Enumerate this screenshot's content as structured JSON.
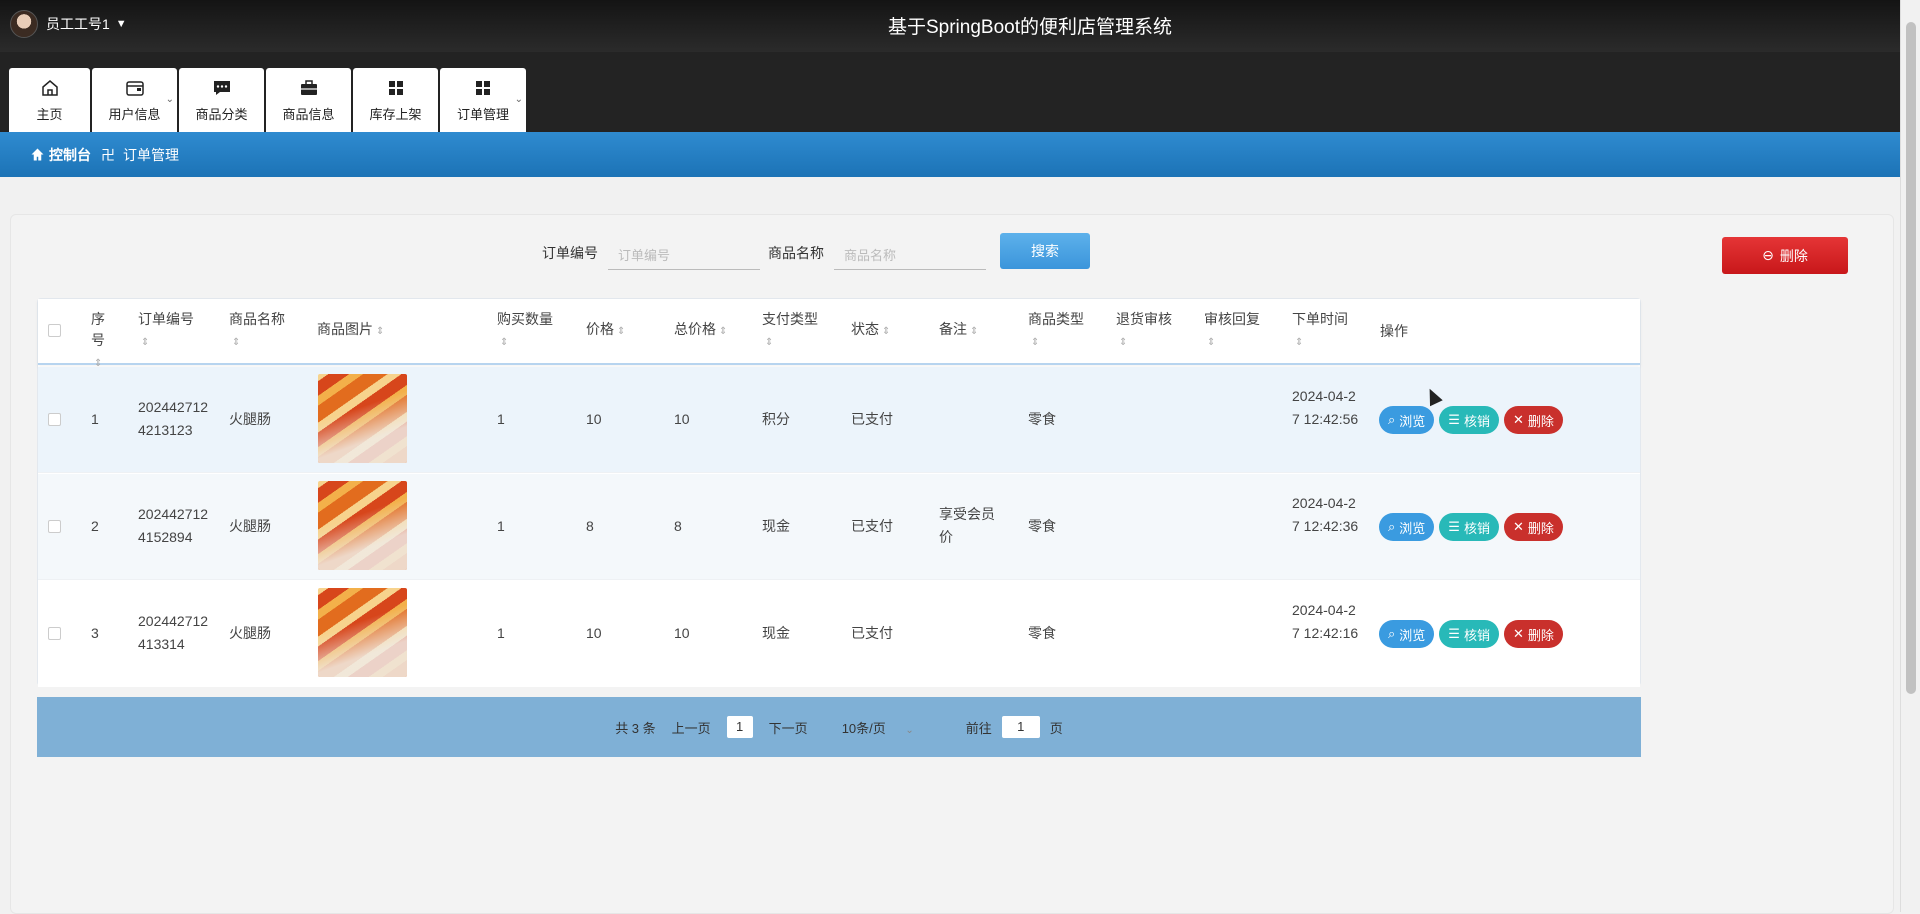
{
  "header": {
    "user_name": "员工工号1",
    "title": "基于SpringBoot的便利店管理系统"
  },
  "nav": [
    {
      "label": "主页",
      "icon": "home-icon"
    },
    {
      "label": "用户信息",
      "icon": "wallet-icon"
    },
    {
      "label": "商品分类",
      "icon": "chat-icon"
    },
    {
      "label": "商品信息",
      "icon": "briefcase-icon"
    },
    {
      "label": "库存上架",
      "icon": "grid-icon"
    },
    {
      "label": "订单管理",
      "icon": "grid-icon"
    }
  ],
  "breadcrumb": {
    "home": "控制台",
    "current": "订单管理"
  },
  "search": {
    "order_label": "订单编号",
    "order_placeholder": "订单编号",
    "goods_label": "商品名称",
    "goods_placeholder": "商品名称",
    "button": "搜索"
  },
  "delete_button": "删除",
  "table": {
    "headers": {
      "seq": "序号",
      "order": "订单编号",
      "name": "商品名称",
      "image": "商品图片",
      "qty": "购买数量",
      "price": "价格",
      "total": "总价格",
      "paytype": "支付类型",
      "status": "状态",
      "remark": "备注",
      "category": "商品类型",
      "refund": "退货审核",
      "reply": "审核回复",
      "time": "下单时间",
      "ops": "操作"
    },
    "rows": [
      {
        "seq": "1",
        "order": "2024427124213123",
        "name": "火腿肠",
        "qty": "1",
        "price": "10",
        "total": "10",
        "paytype": "积分",
        "status": "已支付",
        "remark": "",
        "category": "零食",
        "time": "2024-04-27 12:42:56"
      },
      {
        "seq": "2",
        "order": "2024427124152894",
        "name": "火腿肠",
        "qty": "1",
        "price": "8",
        "total": "8",
        "paytype": "现金",
        "status": "已支付",
        "remark": "享受会员价",
        "category": "零食",
        "time": "2024-04-27 12:42:36"
      },
      {
        "seq": "3",
        "order": "202442712413314",
        "name": "火腿肠",
        "qty": "1",
        "price": "10",
        "total": "10",
        "paytype": "现金",
        "status": "已支付",
        "remark": "",
        "category": "零食",
        "time": "2024-04-27 12:42:16"
      }
    ],
    "ops": {
      "view": "浏览",
      "verify": "核销",
      "delete": "删除"
    }
  },
  "pager": {
    "total": "共 3 条",
    "prev": "上一页",
    "page": "1",
    "next": "下一页",
    "size": "10条/页",
    "goto": "前往",
    "goto_page": "1",
    "page_unit": "页"
  }
}
